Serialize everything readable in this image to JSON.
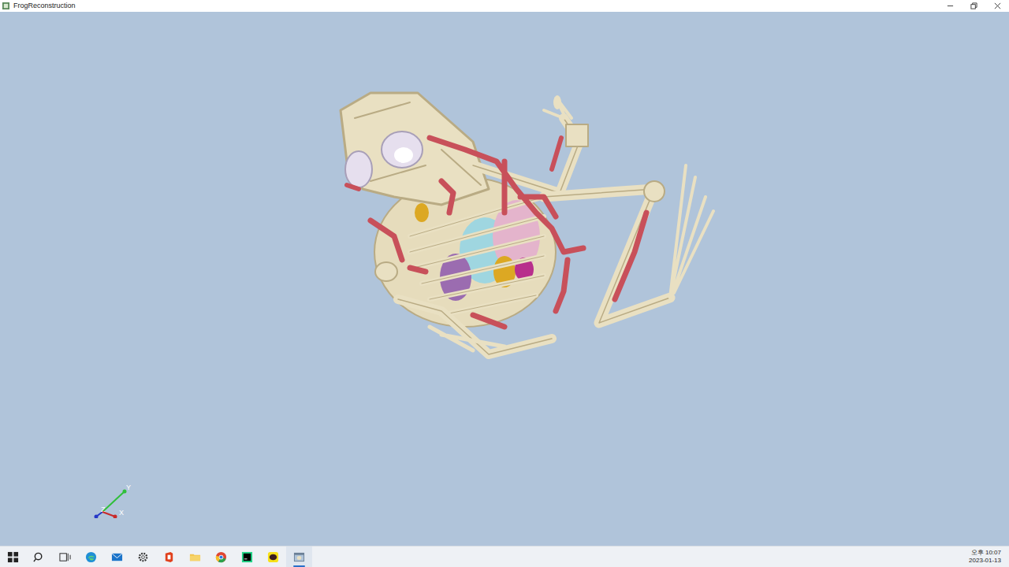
{
  "window": {
    "title": "FrogReconstruction"
  },
  "axes": [
    {
      "label": "Y",
      "color": "#2fbf3a"
    },
    {
      "label": "Z",
      "color": "#2638c8"
    },
    {
      "label": "X",
      "color": "#c82a2a"
    }
  ],
  "taskbar": {
    "apps": [
      {
        "selected": false
      },
      {
        "selected": false
      },
      {
        "selected": false
      },
      {
        "selected": false
      },
      {
        "selected": false
      },
      {
        "selected": false
      },
      {
        "selected": false
      },
      {
        "selected": false
      },
      {
        "selected": false
      },
      {
        "selected": false
      },
      {
        "selected": false
      },
      {
        "selected": true
      }
    ],
    "clock": {
      "time": "오후 10:07",
      "date": "2023-01-13"
    }
  }
}
